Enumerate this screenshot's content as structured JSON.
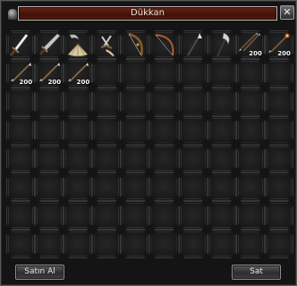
{
  "window": {
    "title": "Dükkan",
    "close_label": "✕"
  },
  "grid": {
    "columns": 10,
    "rows": 8,
    "items": [
      {
        "slot": 0,
        "icon": "sword-icon",
        "qty": ""
      },
      {
        "slot": 1,
        "icon": "broadsword-icon",
        "qty": ""
      },
      {
        "slot": 2,
        "icon": "crescent-blade-and-fan-icon",
        "qty": ""
      },
      {
        "slot": 3,
        "icon": "twin-daggers-icon",
        "qty": ""
      },
      {
        "slot": 4,
        "icon": "bow-icon",
        "qty": ""
      },
      {
        "slot": 5,
        "icon": "longbow-icon",
        "qty": ""
      },
      {
        "slot": 6,
        "icon": "spear-icon",
        "qty": ""
      },
      {
        "slot": 7,
        "icon": "glaive-icon",
        "qty": ""
      },
      {
        "slot": 8,
        "icon": "arrow-bundle-icon",
        "qty": "200"
      },
      {
        "slot": 9,
        "icon": "fire-arrow-bundle-icon",
        "qty": "200"
      },
      {
        "slot": 10,
        "icon": "arrow-icon",
        "qty": "200"
      },
      {
        "slot": 11,
        "icon": "arrow-icon",
        "qty": "200"
      },
      {
        "slot": 12,
        "icon": "arrow-icon",
        "qty": "200"
      }
    ]
  },
  "buttons": {
    "buy_label": "Satın Al",
    "sell_label": "Sat"
  }
}
